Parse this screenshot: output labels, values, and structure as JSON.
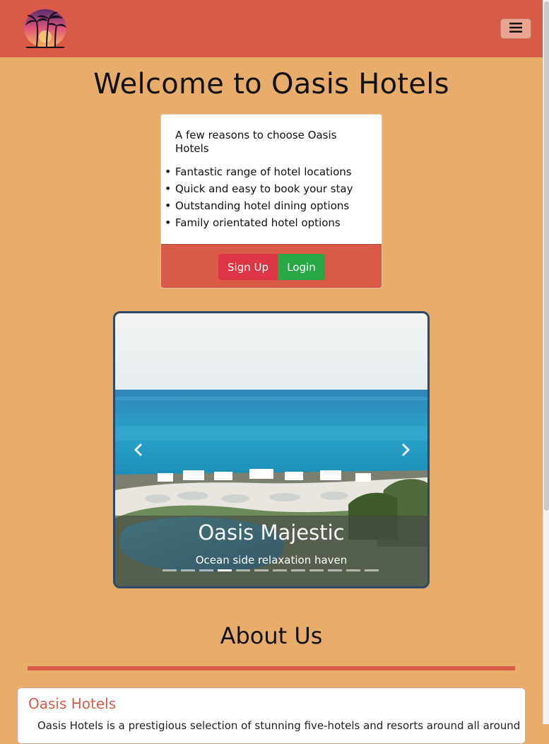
{
  "navbar": {
    "logo_icon": "palm-tree-sunset-logo",
    "menu_icon": "hamburger-menu-icon",
    "brand_color": "#d95b47"
  },
  "page": {
    "background": "#e8ac6b",
    "welcome_title": "Welcome to Oasis Hotels"
  },
  "reasons": {
    "heading": "A few reasons to choose Oasis Hotels",
    "items": [
      "Fantastic range of hotel locations",
      "Quick and easy to book your stay",
      "Outstanding hotel dining options",
      "Family orientated hotel options"
    ],
    "signup_label": "Sign Up",
    "login_label": "Login",
    "signup_color": "#dc3545",
    "login_color": "#28a745"
  },
  "carousel": {
    "caption_title": "Oasis Majestic",
    "caption_subtitle": "Ocean side relaxation haven",
    "indicator_count": 12,
    "active_index": 3,
    "prev_icon": "chevron-left-icon",
    "next_icon": "chevron-right-icon"
  },
  "about": {
    "heading": "About Us",
    "card_title": "Oasis Hotels",
    "card_text": "Oasis Hotels is a prestigious selection of stunning five-hotels and resorts around all around"
  }
}
